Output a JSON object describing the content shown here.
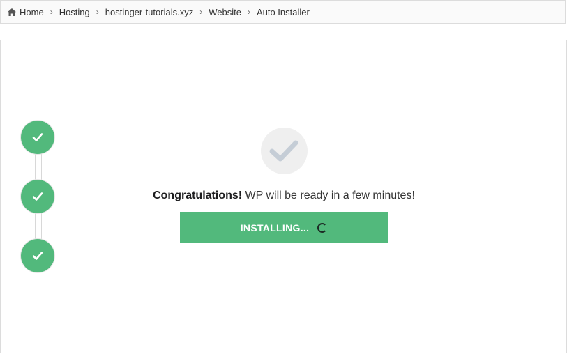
{
  "breadcrumb": {
    "items": [
      {
        "label": "Home",
        "icon": "home-icon"
      },
      {
        "label": "Hosting"
      },
      {
        "label": "hostinger-tutorials.xyz"
      },
      {
        "label": "Website"
      },
      {
        "label": "Auto Installer"
      }
    ]
  },
  "steps": [
    {
      "status": "complete",
      "icon": "checkmark-icon"
    },
    {
      "status": "complete",
      "icon": "checkmark-icon"
    },
    {
      "status": "complete",
      "icon": "checkmark-icon"
    }
  ],
  "result": {
    "icon": "checkmark-icon",
    "title": "Congratulations!",
    "message": " WP will be ready in a few minutes!"
  },
  "install_button": {
    "label": "INSTALLING...",
    "state": "loading"
  },
  "colors": {
    "accent": "#52b97c",
    "muted_check": "#c5cdd6",
    "check_bg": "#efefef"
  }
}
